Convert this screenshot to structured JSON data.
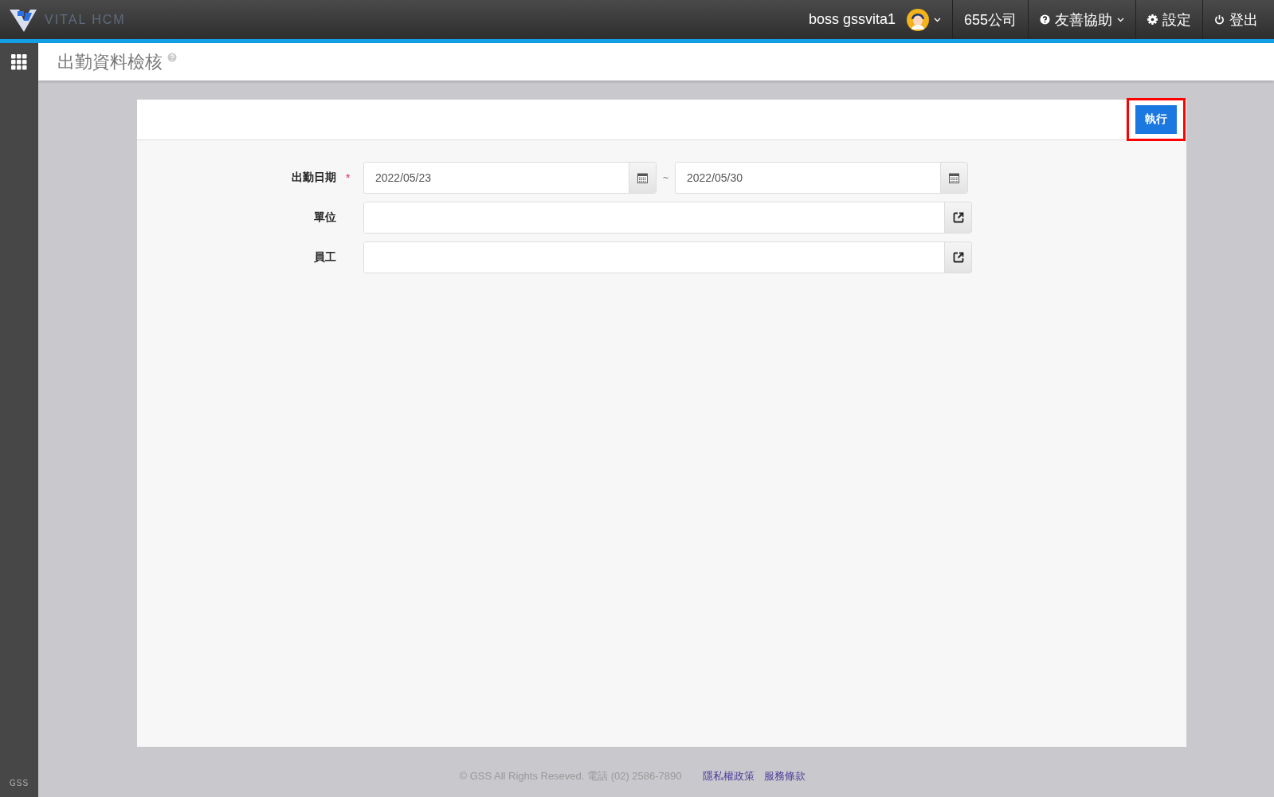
{
  "brand": {
    "name": "VITAL HCM"
  },
  "topbar": {
    "user": "boss gssvita1",
    "company": "655公司",
    "items": [
      {
        "kind": "help",
        "label": "友善協助",
        "dropdown": true
      },
      {
        "kind": "settings",
        "label": "設定",
        "dropdown": false
      },
      {
        "kind": "logout",
        "label": "登出",
        "dropdown": false
      }
    ]
  },
  "page": {
    "title": "出勤資料檢核"
  },
  "toolbar": {
    "buttons": [
      {
        "label": "執行",
        "highlighted": true
      }
    ]
  },
  "form": {
    "required_mark": "*",
    "fields": [
      {
        "kind": "date-range",
        "label": "出勤日期",
        "required": true,
        "from": "2022/05/23",
        "separator": "~",
        "to": "2022/05/30"
      },
      {
        "kind": "picker",
        "label": "單位",
        "required": false
      },
      {
        "kind": "picker",
        "label": "員工",
        "required": false
      }
    ]
  },
  "sidebar": {
    "footer": "GSS"
  },
  "footer": {
    "copyright": "© GSS All Rights Reseved. 電話 (02) 2586-7890",
    "links": [
      "隱私權政策",
      "服務條款"
    ]
  }
}
